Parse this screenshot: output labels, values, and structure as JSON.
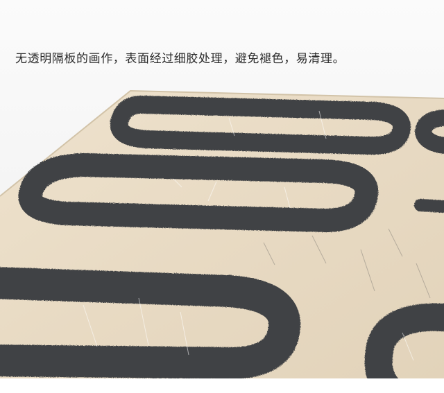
{
  "caption": {
    "text": "无透明隔板的画作，表面经过细胶处理，避免褪色，易清理。"
  },
  "photo": {
    "background_color": "#f3f3f3",
    "board_color": "#e7d9c2",
    "paint_color": "#3f4244"
  }
}
